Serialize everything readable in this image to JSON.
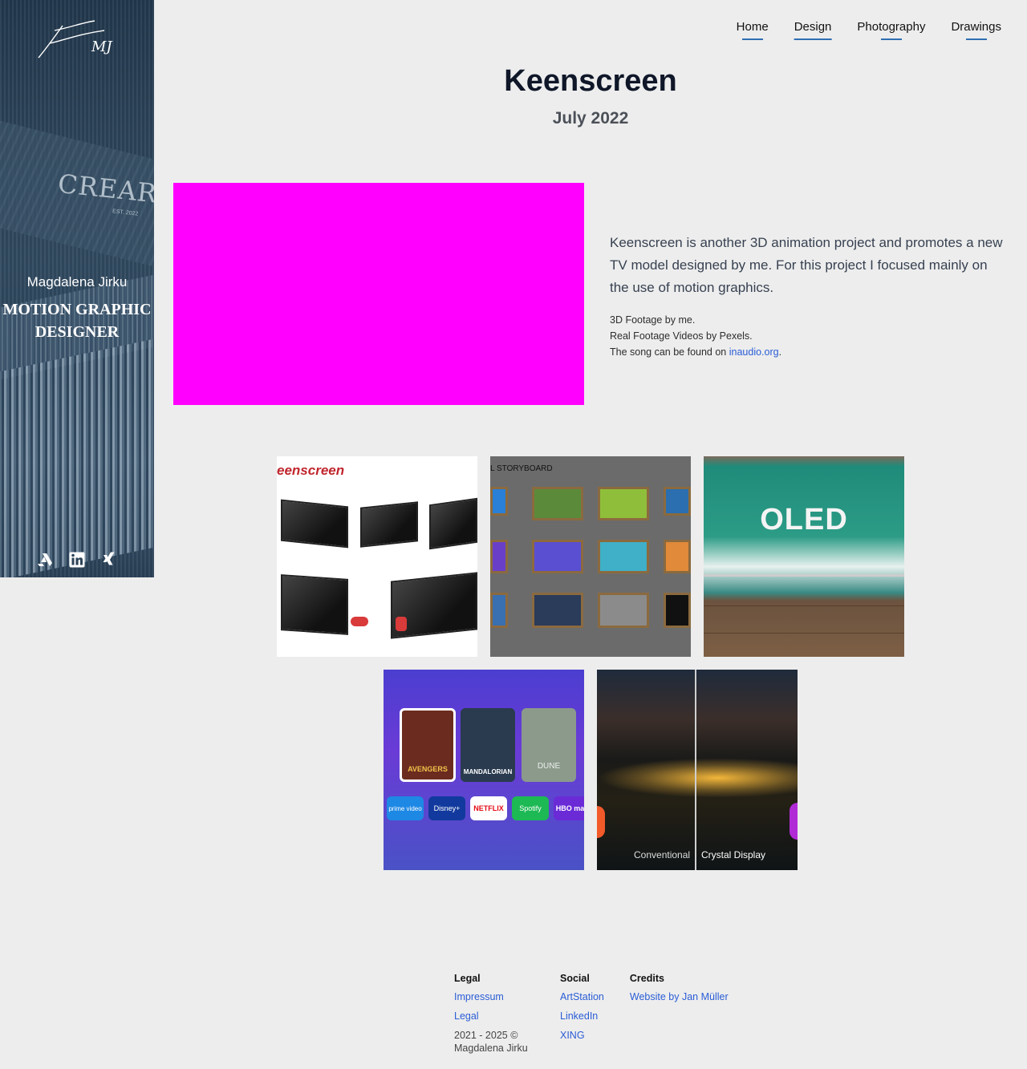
{
  "sidebar": {
    "name": "Magdalena Jirku",
    "title": "MOTION GRAPHIC DESIGNER",
    "background_text": "CREARTI",
    "background_small": "EST. 2022",
    "social_icons": [
      "artstation-icon",
      "linkedin-icon",
      "xing-icon"
    ]
  },
  "nav": {
    "items": [
      "Home",
      "Design",
      "Photography",
      "Drawings"
    ],
    "active": "Design"
  },
  "project": {
    "title": "Keenscreen",
    "date": "July 2022",
    "lead": "Keenscreen is another 3D animation project and promotes a new TV model designed by me. For this project I focused mainly on the use of motion graphics.",
    "credit1": "3D Footage by me.",
    "credit2": "Real Footage Videos by Pexels.",
    "credit3_prefix": "The song can be found on ",
    "credit3_link": "inaudio.org",
    "credit3_suffix": "."
  },
  "gallery": {
    "g1_heading": "eenscreen",
    "g2_heading": "L STORYBOARD",
    "g3_text": "OLED",
    "g4_apps": [
      "prime video",
      "Disney+",
      "NETFLIX",
      "Spotify",
      "HBO max"
    ],
    "g4_posters": [
      "AVENGERS",
      "MANDALORIAN",
      "DUNE"
    ],
    "g5_left": "Conventional",
    "g5_right": "Crystal Display"
  },
  "footer": {
    "legal_heading": "Legal",
    "legal_links": [
      "Impressum",
      "Legal"
    ],
    "copyright": "2021 - 2025 © Magdalena Jirku",
    "social_heading": "Social",
    "social_links": [
      "ArtStation",
      "LinkedIn",
      "XING"
    ],
    "credits_heading": "Credits",
    "credits_link": "Website by Jan Müller"
  },
  "colors": {
    "accent": "#2f6fb3",
    "link": "#2a5dd6",
    "video_placeholder": "#ff00ff",
    "page_bg": "#ededed"
  }
}
